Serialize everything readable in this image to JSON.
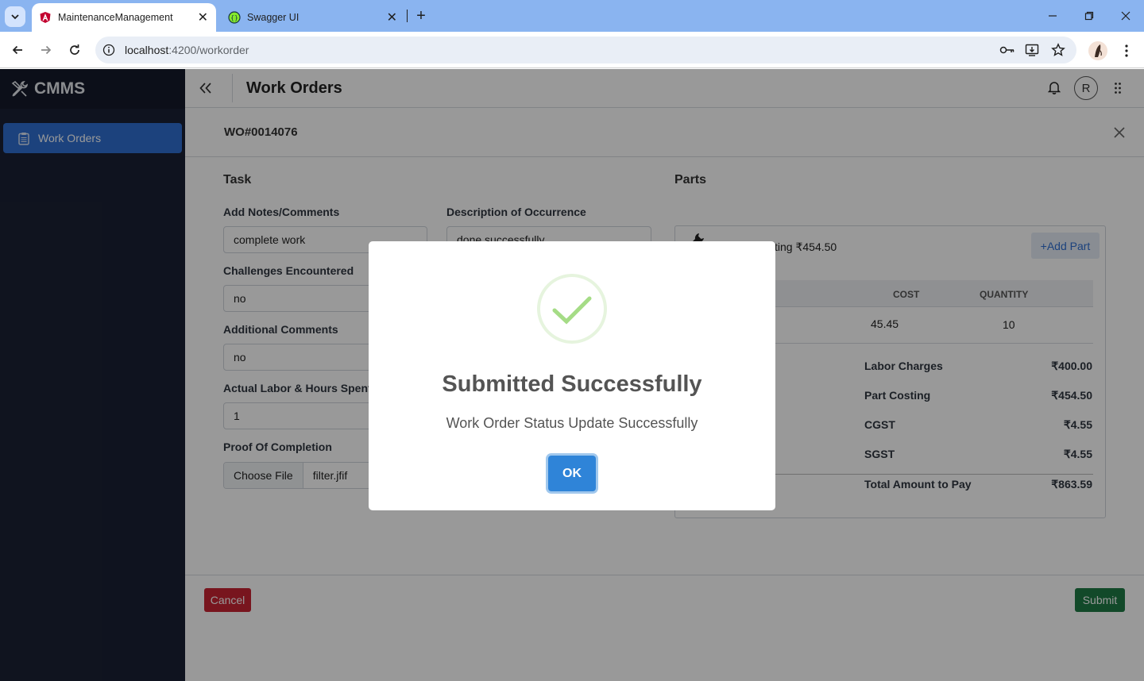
{
  "browser": {
    "tabs": [
      {
        "title": "MaintenanceManagement",
        "active": true
      },
      {
        "title": "Swagger UI",
        "active": false
      }
    ],
    "url_host": "localhost",
    "url_path": ":4200/workorder"
  },
  "app": {
    "brand": "CMMS",
    "sidebar_items": [
      {
        "label": "Work Orders",
        "active": true
      }
    ],
    "header_title": "Work Orders",
    "avatar_initial": "R"
  },
  "workorder": {
    "id": "WO#0014076",
    "task_heading": "Task",
    "parts_heading": "Parts",
    "fields": {
      "notes_label": "Add Notes/Comments",
      "notes_value": "complete work",
      "description_label": "Description of Occurrence",
      "description_value": "done successfully",
      "challenges_label": "Challenges Encountered",
      "challenges_value": "no",
      "additional_label": "Additional Comments",
      "additional_value": "no",
      "labor_label": "Actual Labor & Hours Spent",
      "labor_value": "1",
      "proof_label": "Proof Of Completion",
      "choose_file": "Choose File",
      "file_name": "filter.jfif"
    },
    "parts": {
      "costing_text": "sting ₹454.50",
      "add_part": "+Add Part",
      "columns": [
        "COST",
        "QUANTITY"
      ],
      "rows": [
        {
          "cost": "45.45",
          "quantity": "10"
        }
      ],
      "summary": [
        {
          "label": "Labor Charges",
          "value": "₹400.00"
        },
        {
          "label": "Part Costing",
          "value": "₹454.50"
        },
        {
          "label": "CGST",
          "value": "₹4.55"
        },
        {
          "label": "SGST",
          "value": "₹4.55"
        }
      ],
      "total_label": "Total Amount to Pay",
      "total_value": "₹863.59"
    },
    "cancel": "Cancel",
    "submit": "Submit"
  },
  "dialog": {
    "title": "Submitted Successfully",
    "message": "Work Order Status Update Successfully",
    "ok": "OK"
  },
  "colors": {
    "sidebar_bg": "#1a2134",
    "active_nav": "#2f6fd1",
    "cancel": "#c82333",
    "submit": "#1e7b45",
    "ok": "#2f84d8",
    "success": "#a5dc86"
  }
}
